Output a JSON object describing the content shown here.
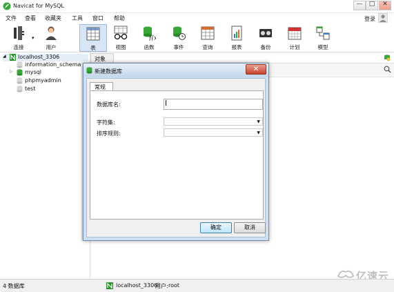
{
  "window": {
    "title": "Navicat for MySQL",
    "min_glyph": "—",
    "max_glyph": "□",
    "close_glyph": "✕"
  },
  "menubar": {
    "items": [
      "文件",
      "查看",
      "收藏夹",
      "工具",
      "窗口",
      "帮助"
    ],
    "login_label": "登录"
  },
  "toolbar": {
    "items": [
      {
        "label": "连接",
        "icon": "plug-icon"
      },
      {
        "label": "用户",
        "icon": "user-icon"
      },
      {
        "label": "表",
        "icon": "table-icon"
      },
      {
        "label": "视图",
        "icon": "view-glasses-icon"
      },
      {
        "label": "函数",
        "icon": "function-icon"
      },
      {
        "label": "事件",
        "icon": "event-clock-icon"
      },
      {
        "label": "查询",
        "icon": "query-grid-icon"
      },
      {
        "label": "报表",
        "icon": "report-icon"
      },
      {
        "label": "备份",
        "icon": "backup-icon"
      },
      {
        "label": "计划",
        "icon": "calendar-icon"
      },
      {
        "label": "模型",
        "icon": "model-icon"
      }
    ]
  },
  "tree": {
    "connection": "localhost_3306",
    "databases": [
      "information_schema",
      "mysql",
      "phpmyadmin",
      "test"
    ]
  },
  "objects_tab": {
    "label": "对象"
  },
  "statusbar": {
    "db_count": "4 数据库",
    "connection": "localhost_3306",
    "user_label": "用户:",
    "user": "root"
  },
  "watermark": {
    "text": "亿速云"
  },
  "dialog": {
    "title": "新建数据库",
    "close_glyph": "✕",
    "tab": "常规",
    "fields": {
      "db_name_label": "数据库名:",
      "db_name_value": "",
      "charset_label": "字符集:",
      "charset_value": "",
      "collation_label": "排序规则:",
      "collation_value": ""
    },
    "ok_label": "确定",
    "cancel_label": "取消"
  },
  "colors": {
    "dialog_frame": "#cfe0f1",
    "close_red": "#c7422a",
    "navicat_green": "#3aa63a"
  }
}
